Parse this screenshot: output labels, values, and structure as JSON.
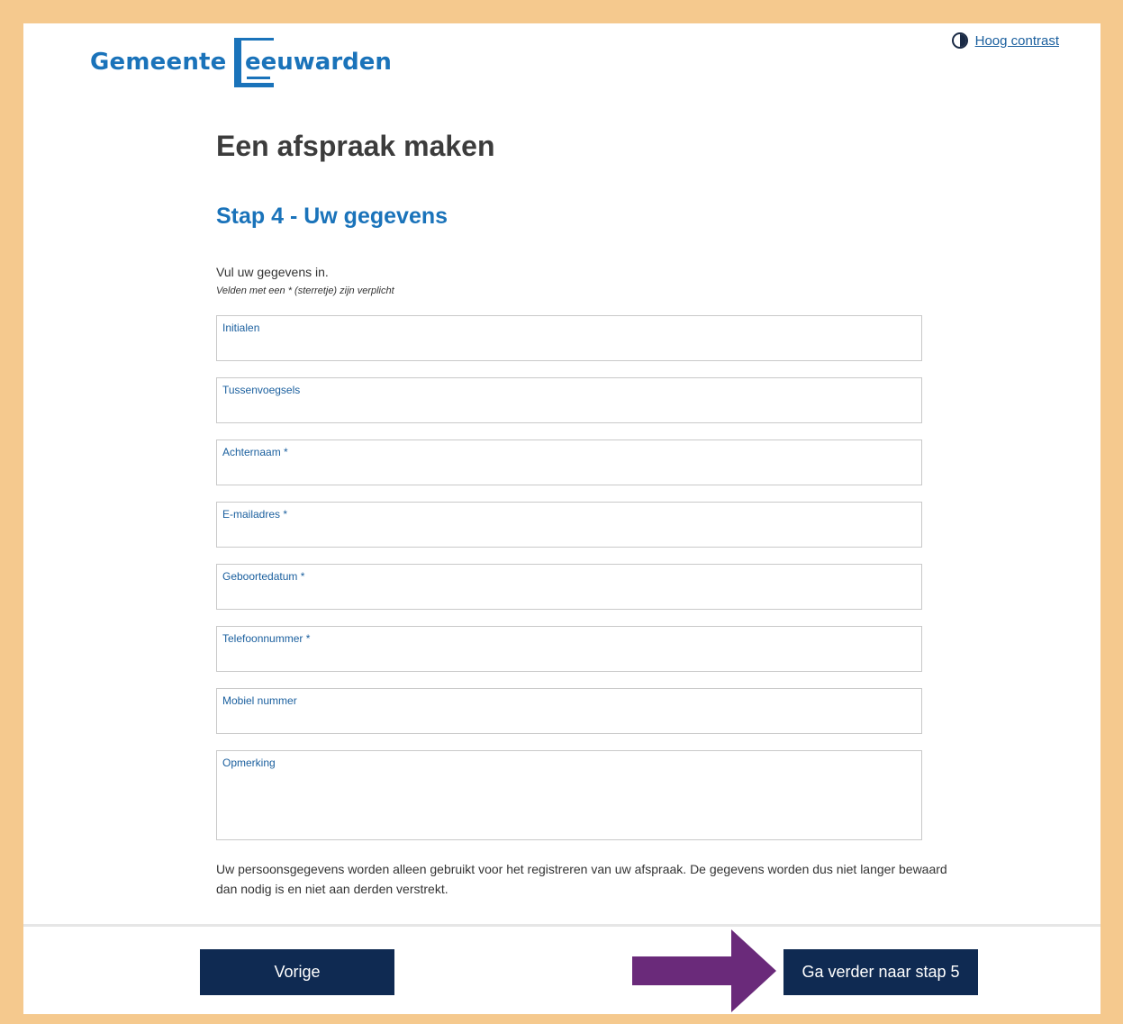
{
  "header": {
    "logo_word_1": "Gemeente",
    "logo_word_2": "eeuwarden",
    "logo_letter": "L",
    "contrast_link": "Hoog contrast"
  },
  "page": {
    "title": "Een afspraak maken",
    "step_title": "Stap 4 - Uw gegevens",
    "intro": "Vul uw gegevens in.",
    "required_note": "Velden met een * (sterretje) zijn verplicht"
  },
  "form": {
    "fields": [
      {
        "label": "Initialen",
        "value": ""
      },
      {
        "label": "Tussenvoegsels",
        "value": ""
      },
      {
        "label": "Achternaam *",
        "value": ""
      },
      {
        "label": "E-mailadres *",
        "value": ""
      },
      {
        "label": "Geboortedatum *",
        "value": ""
      },
      {
        "label": "Telefoonnummer *",
        "value": ""
      },
      {
        "label": "Mobiel nummer",
        "value": ""
      },
      {
        "label": "Opmerking",
        "value": ""
      }
    ]
  },
  "privacy_text": "Uw persoonsgegevens worden alleen gebruikt voor het registreren van uw afspraak. De gegevens worden dus niet langer bewaard dan nodig is en niet aan derden verstrekt.",
  "footer": {
    "prev_label": "Vorige",
    "next_label": "Ga verder naar stap 5"
  },
  "colors": {
    "brand_blue": "#1a73ba",
    "button_navy": "#0f2a52",
    "frame_orange": "#f5c98e",
    "annotation_arrow": "#6a2a7a"
  },
  "icons": {
    "contrast": "contrast-icon",
    "annotation": "arrow-right-icon"
  }
}
